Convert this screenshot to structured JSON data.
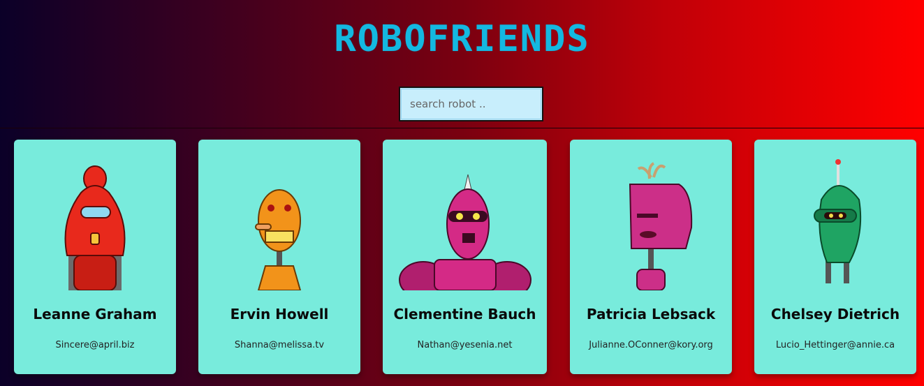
{
  "app": {
    "title": "ROBOFRIENDS"
  },
  "search": {
    "placeholder": "search robot .."
  },
  "robots": [
    {
      "name": "Leanne Graham",
      "email": "Sincere@april.biz",
      "color": "#e8291c"
    },
    {
      "name": "Ervin Howell",
      "email": "Shanna@melissa.tv",
      "color": "#f2931a"
    },
    {
      "name": "Clementine Bauch",
      "email": "Nathan@yesenia.net",
      "color": "#d42a86"
    },
    {
      "name": "Patricia Lebsack",
      "email": "Julianne.OConner@kory.org",
      "color": "#cc2f88"
    },
    {
      "name": "Chelsey Dietrich",
      "email": "Lucio_Hettinger@annie.ca",
      "color": "#1fa463"
    }
  ]
}
